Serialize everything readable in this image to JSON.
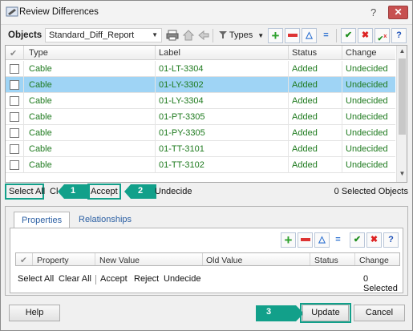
{
  "window": {
    "title": "Review Differences",
    "help": "?",
    "close": "✕"
  },
  "toolbar": {
    "objects_label": "Objects",
    "report_value": "Standard_Diff_Report",
    "types_label": "Types"
  },
  "grid": {
    "columns": [
      "Type",
      "Label",
      "Status",
      "Change"
    ],
    "rows": [
      {
        "type": "Cable",
        "label": "01-LT-3304",
        "status": "Added",
        "change": "Undecided",
        "selected": false
      },
      {
        "type": "Cable",
        "label": "01-LY-3302",
        "status": "Added",
        "change": "Undecided",
        "selected": true
      },
      {
        "type": "Cable",
        "label": "01-LY-3304",
        "status": "Added",
        "change": "Undecided",
        "selected": false
      },
      {
        "type": "Cable",
        "label": "01-PT-3305",
        "status": "Added",
        "change": "Undecided",
        "selected": false
      },
      {
        "type": "Cable",
        "label": "01-PY-3305",
        "status": "Added",
        "change": "Undecided",
        "selected": false
      },
      {
        "type": "Cable",
        "label": "01-TT-3101",
        "status": "Added",
        "change": "Undecided",
        "selected": false
      },
      {
        "type": "Cable",
        "label": "01-TT-3102",
        "status": "Added",
        "change": "Undecided",
        "selected": false
      }
    ]
  },
  "actions": {
    "select_all": "Select All",
    "clear_fragment": "Cl",
    "accept": "Accept",
    "undecide": "Undecide",
    "selected_count": "0 Selected Objects"
  },
  "callouts": {
    "one": "1",
    "two": "2",
    "three": "3"
  },
  "lower": {
    "tabs": [
      "Properties",
      "Relationships"
    ],
    "columns": [
      "Property",
      "New Value",
      "Old Value",
      "Status",
      "Change"
    ],
    "actions": [
      "Select All",
      "Clear All",
      "Accept",
      "Reject",
      "Undecide"
    ],
    "selected_count": "0 Selected"
  },
  "buttons": {
    "help": "Help",
    "update": "Update",
    "cancel": "Cancel"
  },
  "colors": {
    "accent": "#12a08a",
    "selection": "#9fd4f5",
    "added_text": "#1e7a1e"
  }
}
